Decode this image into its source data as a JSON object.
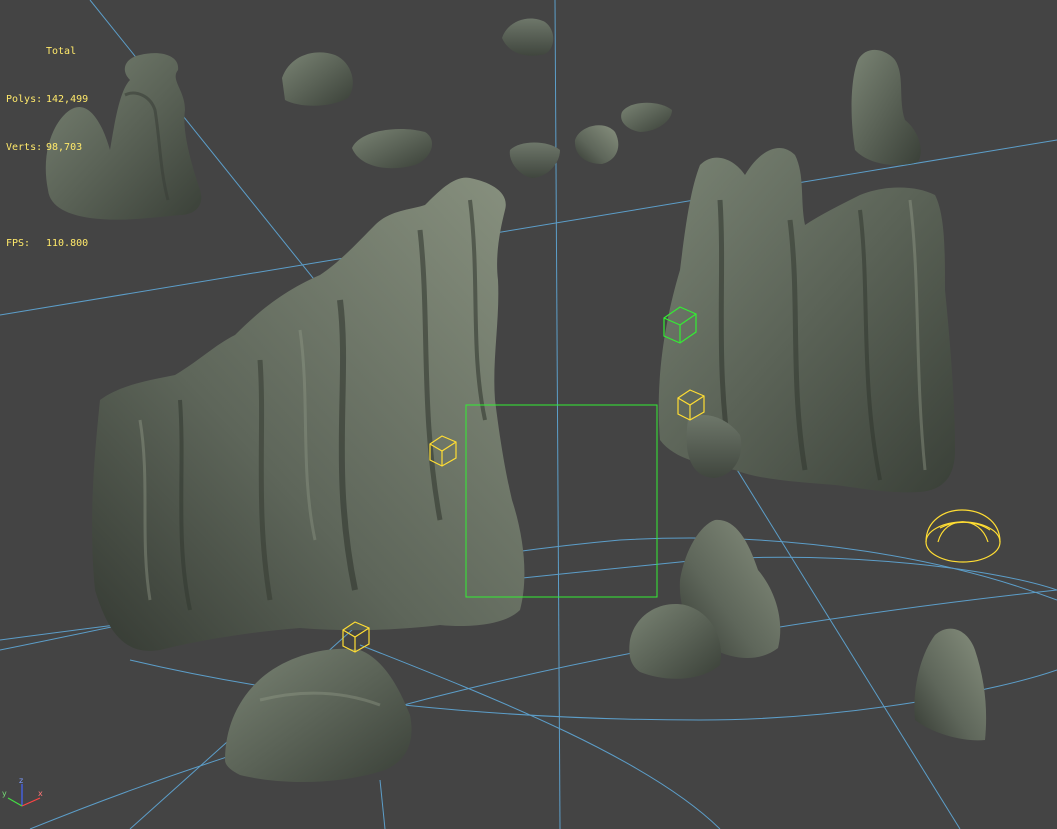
{
  "stats": {
    "total_label": "Total",
    "polys_label": "Polys:",
    "polys_value": "142,499",
    "verts_label": "Verts:",
    "verts_value": "98,703",
    "fps_label": "FPS:",
    "fps_value": "110.800"
  },
  "axis": {
    "x": "x",
    "y": "y",
    "z": "z"
  },
  "colors": {
    "background": "#444444",
    "stats_text": "#ffe96a",
    "selection_green": "#33ee33",
    "helper_yellow": "#ffdd33",
    "spline_blue": "#5fa8d8",
    "rock": "#5a6256"
  }
}
